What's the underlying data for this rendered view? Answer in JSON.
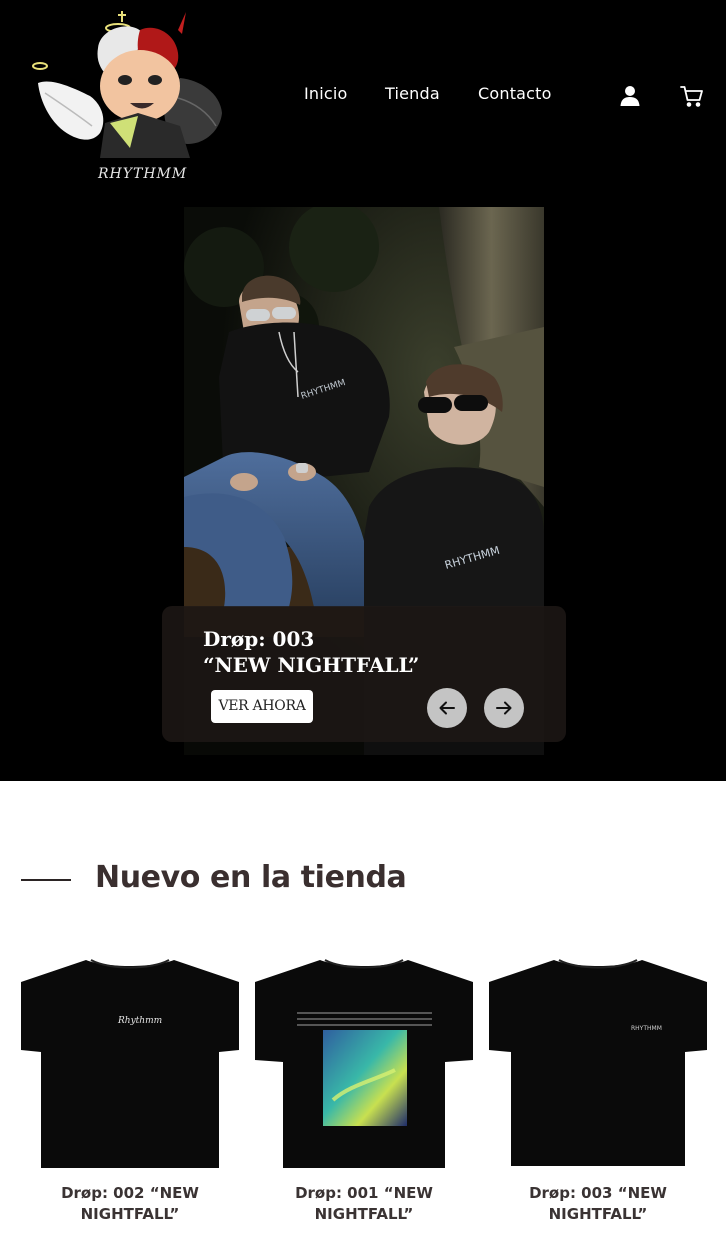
{
  "brand": {
    "logo_text": "RHYTHMM"
  },
  "nav": {
    "items": [
      {
        "label": "Inicio"
      },
      {
        "label": "Tienda"
      },
      {
        "label": "Contacto"
      }
    ]
  },
  "icons": {
    "account": "user-icon",
    "cart": "cart-icon"
  },
  "hero": {
    "drop": "Drøp: 003",
    "name": "“NEW NIGHTFALL”",
    "cta_label": "VER AHORA",
    "shirt_print": "RHYTHMM",
    "prev_icon": "arrow-left-icon",
    "next_icon": "arrow-right-icon"
  },
  "new_in": {
    "title": "Nuevo en la tienda",
    "products": [
      {
        "name": "Drøp: 002 “NEW NIGHTFALL”",
        "print": "Rhythmm"
      },
      {
        "name": "Drøp: 001 “NEW NIGHTFALL”",
        "print": ""
      },
      {
        "name": "Drøp: 003 “NEW NIGHTFALL”",
        "print": "RHYTHMM"
      }
    ]
  },
  "colors": {
    "background_dark": "#000000",
    "background_light": "#ffffff",
    "text_dark": "#3a2f2f",
    "button_grey": "#c4c4c4"
  }
}
